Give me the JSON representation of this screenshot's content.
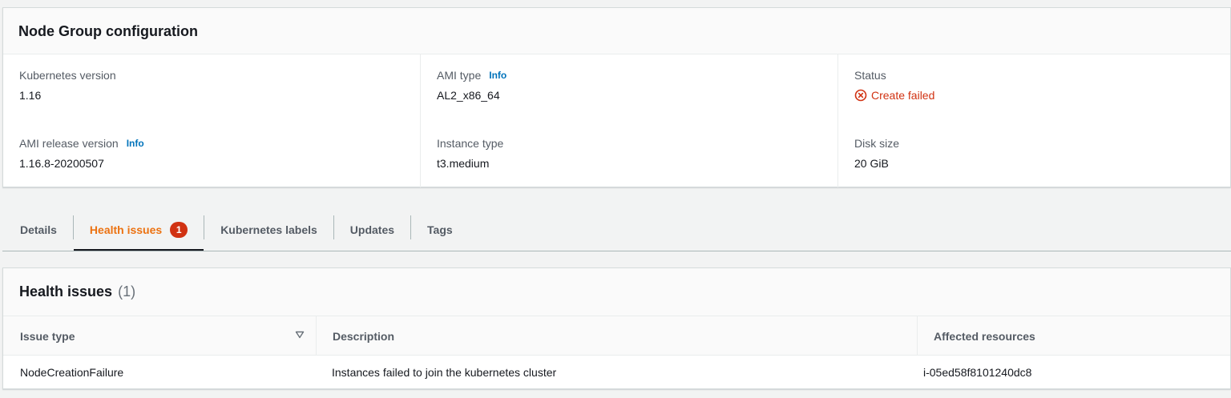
{
  "config": {
    "title": "Node Group configuration",
    "fields": {
      "kubernetes_version": {
        "label": "Kubernetes version",
        "value": "1.16"
      },
      "ami_type": {
        "label": "AMI type",
        "info": "Info",
        "value": "AL2_x86_64"
      },
      "status": {
        "label": "Status",
        "value": "Create failed",
        "icon": "error-circle-icon",
        "color": "#d13212"
      },
      "ami_release_version": {
        "label": "AMI release version",
        "info": "Info",
        "value": "1.16.8-20200507"
      },
      "instance_type": {
        "label": "Instance type",
        "value": "t3.medium"
      },
      "disk_size": {
        "label": "Disk size",
        "value": "20 GiB"
      }
    }
  },
  "tabs": [
    {
      "label": "Details",
      "active": false
    },
    {
      "label": "Health issues",
      "active": true,
      "badge": "1"
    },
    {
      "label": "Kubernetes labels",
      "active": false
    },
    {
      "label": "Updates",
      "active": false
    },
    {
      "label": "Tags",
      "active": false
    }
  ],
  "health": {
    "title": "Health issues",
    "count": "(1)",
    "columns": [
      "Issue type",
      "Description",
      "Affected resources"
    ],
    "rows": [
      [
        "NodeCreationFailure",
        "Instances failed to join the kubernetes cluster",
        "i-05ed58f8101240dc8"
      ]
    ]
  },
  "colors": {
    "accent_orange": "#ec7211",
    "error_red": "#d13212",
    "link_blue": "#0073bb"
  }
}
